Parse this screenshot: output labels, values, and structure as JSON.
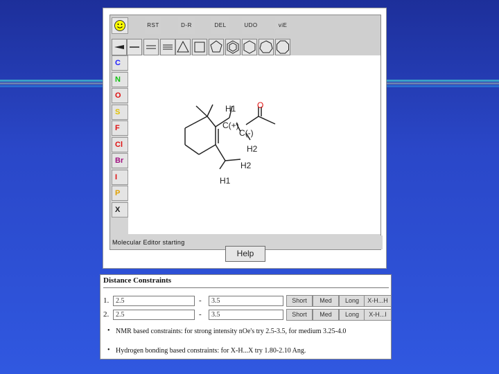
{
  "toolbar": {
    "commands": [
      "RST",
      "D-R",
      "DEL",
      "UDO",
      "viE"
    ],
    "tools": [
      "wedge-bond",
      "single-bond",
      "double-bond",
      "triple-bond",
      "triangle-ring",
      "square-ring",
      "pentagon-ring",
      "benzene-ring",
      "hexagon-ring",
      "heptagon-ring",
      "octagon-ring"
    ]
  },
  "elements": [
    {
      "symbol": "C",
      "color": "#2020ff"
    },
    {
      "symbol": "N",
      "color": "#10c010"
    },
    {
      "symbol": "O",
      "color": "#e01010"
    },
    {
      "symbol": "S",
      "color": "#e0c000"
    },
    {
      "symbol": "F",
      "color": "#e01010"
    },
    {
      "symbol": "Cl",
      "color": "#e01010"
    },
    {
      "symbol": "Br",
      "color": "#a01080"
    },
    {
      "symbol": "I",
      "color": "#e01010"
    },
    {
      "symbol": "P",
      "color": "#e0a000"
    },
    {
      "symbol": "X",
      "color": "#202020"
    }
  ],
  "molecule": {
    "labels": {
      "h1_top": "H1",
      "o": "O",
      "c_plus": "C(+)",
      "c_minus": "C(-)",
      "h2_right": "H2",
      "h2_lower": "H2",
      "h1_lower": "H1"
    }
  },
  "status": "Molecular Editor starting",
  "help_label": "Help",
  "constraints": {
    "title": "Distance Constraints",
    "rows": [
      {
        "num": "1.",
        "min": "2.5",
        "max": "3.5"
      },
      {
        "num": "2.",
        "min": "2.5",
        "max": "3.5"
      }
    ],
    "dash": "-",
    "buttons": [
      "Short",
      "Med",
      "Long",
      "X-H...H",
      "X-H...I"
    ],
    "notes": [
      "NMR based constraints: for strong intensity nOe's try 2.5-3.5, for medium 3.25-4.0",
      "Hydrogen bonding based constraints: for X-H...X try 1.80-2.10 Ang."
    ]
  }
}
